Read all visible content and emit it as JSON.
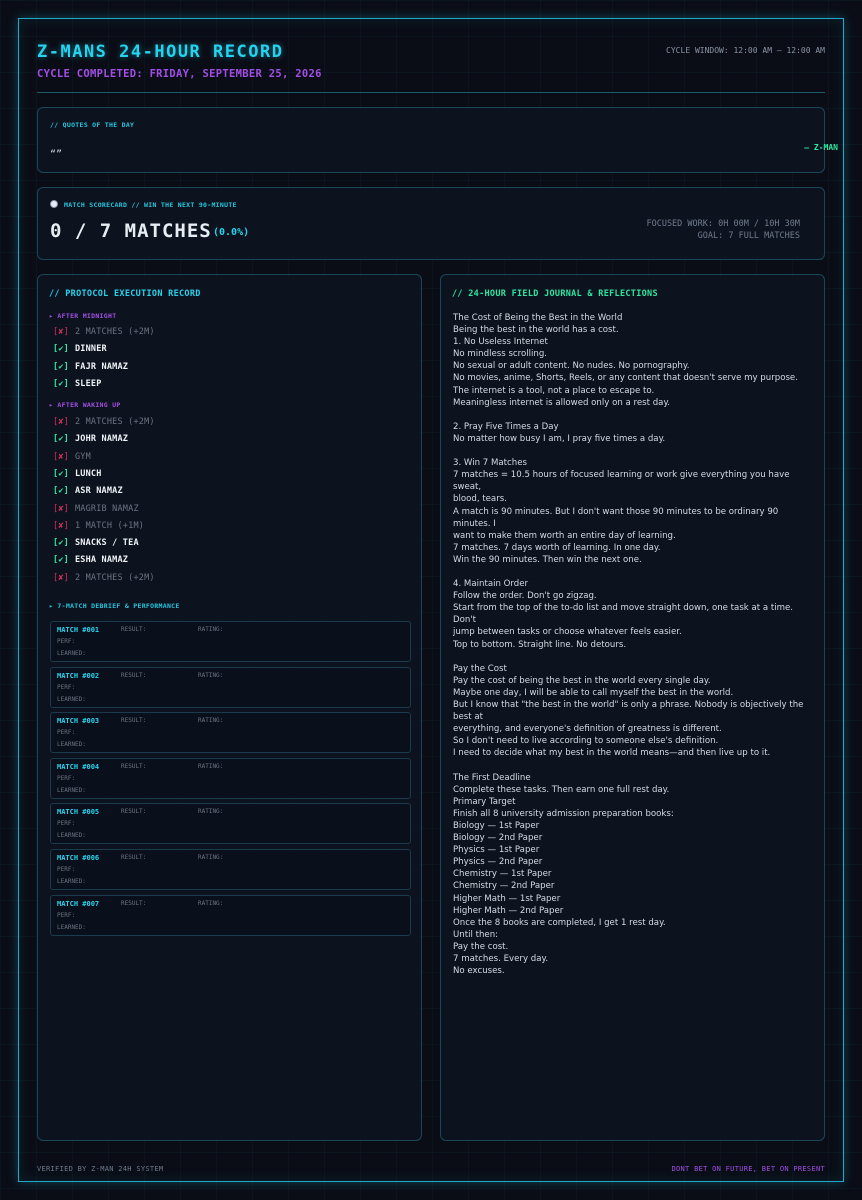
{
  "header": {
    "title": "Z-MANS 24-HOUR RECORD",
    "subtitle": "CYCLE COMPLETED: FRIDAY, SEPTEMBER 25, 2026",
    "cycle_window": "CYCLE WINDOW: 12:00 AM — 12:00 AM"
  },
  "quotes": {
    "label": "// QUOTES OF THE DAY",
    "text": "“”",
    "author": "— Z-MAN"
  },
  "scorecard": {
    "icon": "soccer-ball-icon",
    "label": "MATCH SCORECARD // WIN THE NEXT 90-MINUTE",
    "score": "0 / 7 MATCHES",
    "percent": "(0.0%)",
    "focused_work": "FOCUSED WORK: 0H 00M / 10H 30M",
    "goal": "GOAL: 7 FULL MATCHES"
  },
  "protocol": {
    "title": "// PROTOCOL EXECUTION RECORD",
    "sections": [
      {
        "label": "▸ AFTER MIDNIGHT",
        "tasks": [
          {
            "mark": "[✘]",
            "label": "2 MATCHES (+2M)",
            "done": false
          },
          {
            "mark": "[✔]",
            "label": "DINNER",
            "done": true
          },
          {
            "mark": "[✔]",
            "label": "FAJR NAMAZ",
            "done": true
          },
          {
            "mark": "[✔]",
            "label": "SLEEP",
            "done": true
          }
        ]
      },
      {
        "label": "▸ AFTER WAKING UP",
        "tasks": [
          {
            "mark": "[✘]",
            "label": "2 MATCHES (+2M)",
            "done": false
          },
          {
            "mark": "[✔]",
            "label": "JOHR NAMAZ",
            "done": true
          },
          {
            "mark": "[✘]",
            "label": "GYM",
            "done": false
          },
          {
            "mark": "[✔]",
            "label": "LUNCH",
            "done": true
          },
          {
            "mark": "[✔]",
            "label": "ASR NAMAZ",
            "done": true
          },
          {
            "mark": "[✘]",
            "label": "MAGRIB NAMAZ",
            "done": false
          },
          {
            "mark": "[✘]",
            "label": "1 MATCH (+1M)",
            "done": false
          },
          {
            "mark": "[✔]",
            "label": "SNACKS / TEA",
            "done": true
          },
          {
            "mark": "[✔]",
            "label": "ESHA NAMAZ",
            "done": true
          },
          {
            "mark": "[✘]",
            "label": "2 MATCHES (+2M)",
            "done": false
          }
        ]
      }
    ],
    "debrief_label": "▸ 7-MATCH DEBRIEF & PERFORMANCE",
    "matches": [
      {
        "title": "MATCH #001",
        "result": "RESULT:",
        "rating": "RATING:",
        "perf": "PERF:",
        "learned": "LEARNED:"
      },
      {
        "title": "MATCH #002",
        "result": "RESULT:",
        "rating": "RATING:",
        "perf": "PERF:",
        "learned": "LEARNED:"
      },
      {
        "title": "MATCH #003",
        "result": "RESULT:",
        "rating": "RATING:",
        "perf": "PERF:",
        "learned": "LEARNED:"
      },
      {
        "title": "MATCH #004",
        "result": "RESULT:",
        "rating": "RATING:",
        "perf": "PERF:",
        "learned": "LEARNED:"
      },
      {
        "title": "MATCH #005",
        "result": "RESULT:",
        "rating": "RATING:",
        "perf": "PERF:",
        "learned": "LEARNED:"
      },
      {
        "title": "MATCH #006",
        "result": "RESULT:",
        "rating": "RATING:",
        "perf": "PERF:",
        "learned": "LEARNED:"
      },
      {
        "title": "MATCH #007",
        "result": "RESULT:",
        "rating": "RATING:",
        "perf": "PERF:",
        "learned": "LEARNED:"
      }
    ]
  },
  "journal": {
    "title": "// 24-HOUR FIELD JOURNAL & REFLECTIONS",
    "lines": [
      "The Cost of Being the Best in the World",
      "Being the best in the world has a cost.",
      "1. No Useless Internet",
      "No mindless scrolling.",
      "No sexual or adult content. No nudes. No pornography.",
      "No movies, anime, Shorts, Reels, or any content that doesn't serve my purpose.",
      "The internet is a tool, not a place to escape to.",
      "Meaningless internet is allowed only on a rest day.",
      "",
      "2. Pray Five Times a Day",
      "No matter how busy I am, I pray five times a day.",
      "",
      "3. Win 7 Matches",
      "7 matches = 10.5 hours of focused learning or work give everything you have sweat,",
      "blood, tears.",
      "A match is 90 minutes. But I don't want those 90 minutes to be ordinary 90 minutes. I",
      "want to make them worth an entire day of learning.",
      "7 matches. 7 days worth of learning. In one day.",
      "Win the 90 minutes. Then win the next one.",
      "",
      "4. Maintain Order",
      "Follow the order. Don't go zigzag.",
      "Start from the top of the to-do list and move straight down, one task at a time. Don't",
      "jump between tasks or choose whatever feels easier.",
      "Top to bottom. Straight line. No detours.",
      "",
      "Pay the Cost",
      "Pay the cost of being the best in the world every single day.",
      "Maybe one day, I will be able to call myself the best in the world.",
      "But I know that \"the best in the world\" is only a phrase. Nobody is objectively the best at",
      "everything, and everyone's definition of greatness is different.",
      "So I don't need to live according to someone else's definition.",
      "I need to decide what my best in the world means—and then live up to it.",
      "",
      "The First Deadline",
      "Complete these tasks. Then earn one full rest day.",
      "Primary Target",
      "Finish all 8 university admission preparation books:",
      "Biology — 1st Paper",
      "Biology — 2nd Paper",
      "Physics — 1st Paper",
      "Physics — 2nd Paper",
      "Chemistry — 1st Paper",
      "Chemistry — 2nd Paper",
      "Higher Math — 1st Paper",
      "Higher Math — 2nd Paper",
      "Once the 8 books are completed, I get 1 rest day.",
      "Until then:",
      "Pay the cost.",
      "7 matches. Every day.",
      "No excuses."
    ]
  },
  "footer": {
    "left": "VERIFIED BY Z-MAN 24H SYSTEM",
    "right": "DONT BET ON FUTURE, BET ON PRESENT"
  }
}
